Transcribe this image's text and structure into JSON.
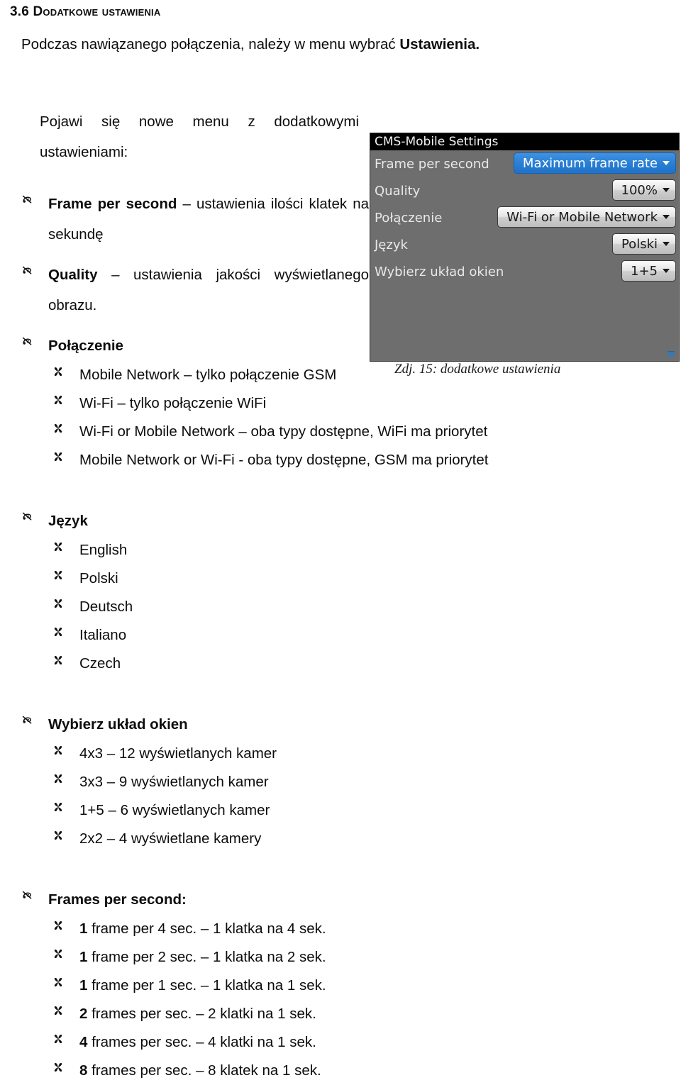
{
  "heading": "3.6 Dodatkowe ustawienia",
  "intro": {
    "before": "Podczas nawiązanego połączenia, należy w menu wybrać ",
    "bold": "Ustawienia."
  },
  "paragraph": "Pojawi się nowe menu z dodatkowymi ustawieniami:",
  "markers": {
    "level1": "pen-flourish-bullet",
    "level2": "four-petal-flower-bullet"
  },
  "sections": [
    {
      "lead": "Frame per second",
      "rest": " – ustawienia ilości klatek na sekundę",
      "items": []
    },
    {
      "lead": "Quality",
      "rest": " – ustawienia jakości wyświetlanego obrazu.",
      "items": []
    },
    {
      "lead": "Połączenie",
      "rest": "",
      "items": [
        "Mobile Network – tylko połączenie GSM",
        "Wi-Fi – tylko połączenie WiFi",
        "Wi-Fi or Mobile Network – oba typy dostępne, WiFi ma priorytet",
        "Mobile Network or Wi-Fi - oba typy dostępne, GSM ma priorytet"
      ]
    },
    {
      "lead": "Język",
      "rest": "",
      "items": [
        "English",
        "Polski",
        "Deutsch",
        "Italiano",
        "Czech"
      ]
    },
    {
      "lead": "Wybierz układ okien",
      "rest": "",
      "items": [
        "4x3 – 12 wyświetlanych kamer",
        "3x3 – 9 wyświetlanych kamer",
        "1+5 – 6 wyświetlanych kamer",
        "2x2 – 4 wyświetlane kamery"
      ]
    },
    {
      "lead": "Frames per second:",
      "rest": "",
      "items": [
        {
          "lead": "1",
          "rest": "  frame per 4 sec. – 1 klatka na 4 sek."
        },
        {
          "lead": "1",
          "rest": "  frame per 2 sec. – 1 klatka na 2 sek."
        },
        {
          "lead": "1",
          "rest": "  frame per 1 sec. – 1 klatka na 1 sek."
        },
        {
          "lead": "2",
          "rest": " frames per sec. – 2 klatki na 1 sek."
        },
        {
          "lead": "4",
          "rest": " frames per sec. – 4 klatki na 1 sek."
        },
        {
          "lead": "8",
          "rest": " frames per sec. – 8 klatek na 1 sek."
        }
      ]
    }
  ],
  "panel": {
    "title": "CMS-Mobile Settings",
    "rows": [
      {
        "label": "Frame per second",
        "value": "Maximum frame rate",
        "accent": true
      },
      {
        "label": "Quality",
        "value": "100%",
        "accent": false
      },
      {
        "label": "Połączenie",
        "value": "Wi-Fi or Mobile Network",
        "accent": false
      },
      {
        "label": "Język",
        "value": "Polski",
        "accent": false
      },
      {
        "label": "Wybierz układ okien",
        "value": "1+5",
        "accent": false
      }
    ],
    "colors": {
      "accent": "#2a7fd4",
      "body": "#6e6e6e",
      "titlebar": "#000000",
      "corner_arrow": "#3a78b4"
    }
  },
  "caption": "Zdj. 15: dodatkowe ustawienia"
}
